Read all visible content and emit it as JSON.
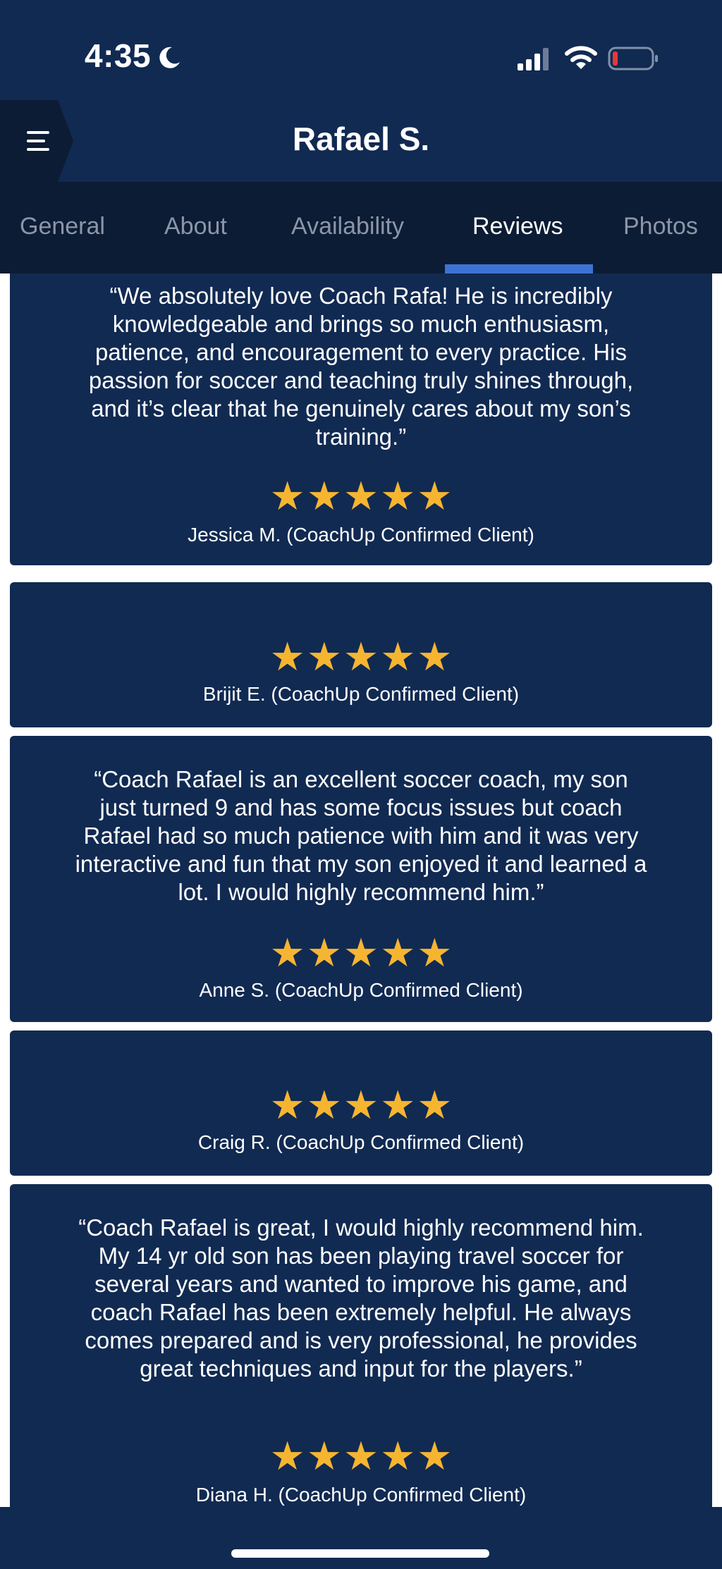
{
  "status_bar": {
    "time": "4:35"
  },
  "header": {
    "title": "Rafael S."
  },
  "tabs": [
    {
      "label": "General"
    },
    {
      "label": "About"
    },
    {
      "label": "Availability"
    },
    {
      "label": "Reviews"
    },
    {
      "label": "Photos"
    }
  ],
  "active_tab": "Reviews",
  "rating_star_glyph": "★",
  "reviews": [
    {
      "text": "“We absolutely love Coach Rafa! He is incredibly knowledgeable and brings so much enthusiasm, patience, and encouragement to every practice. His passion for soccer and teaching truly shines through, and it’s clear that he genuinely cares about my son’s training.”",
      "rating": 5,
      "author": "Jessica M. (CoachUp Confirmed Client)"
    },
    {
      "text": "",
      "rating": 5,
      "author": "Brijit E. (CoachUp Confirmed Client)"
    },
    {
      "text": "“Coach Rafael is an excellent soccer coach, my son just turned 9 and has some focus issues but coach Rafael had so much patience with him and it was very interactive and fun that my son enjoyed it and learned a lot. I would highly recommend him.”",
      "rating": 5,
      "author": "Anne S. (CoachUp Confirmed Client)"
    },
    {
      "text": "",
      "rating": 5,
      "author": "Craig R. (CoachUp Confirmed Client)"
    },
    {
      "text": "“Coach Rafael is great, I would highly recommend him.  My 14 yr old son has been playing travel soccer for several years and wanted to improve his game, and coach Rafael has been extremely helpful.  He always comes prepared and is very professional, he provides great techniques and input for the players.”",
      "rating": 5,
      "author": "Diana H. (CoachUp Confirmed Client)"
    }
  ],
  "colors": {
    "navy": "#112a52",
    "tab_bar": "#0c1c34",
    "accent": "#3d73d6",
    "star": "#f6b531",
    "battery_low": "#e5393c"
  }
}
